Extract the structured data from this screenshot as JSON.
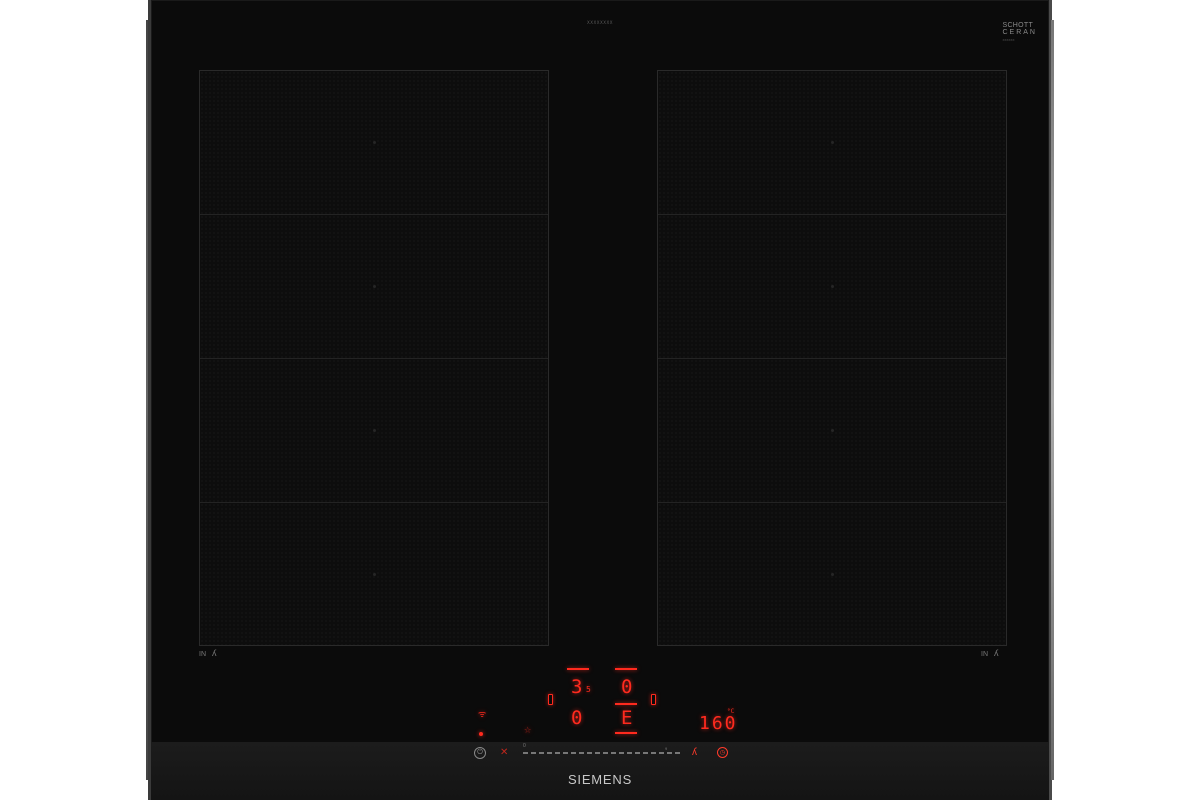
{
  "model_text": "XXXXXXXX",
  "certification": {
    "line1": "SCHOTT",
    "line2": "CERAN",
    "line3": "XXXXXX"
  },
  "zones": {
    "left": {
      "label": "IN",
      "symbol": "ʎ"
    },
    "right": {
      "label": "IN",
      "symbol": "ʎ"
    }
  },
  "display": {
    "top_left_value": "3",
    "top_left_sub": "5",
    "top_right_value": "0",
    "bottom_left_value": "0",
    "bottom_right_value": "E",
    "temperature_value": "160",
    "temperature_unit": "°C",
    "star_symbol": "☆",
    "wifi_symbol": "ᯤ"
  },
  "controls": {
    "power_symbol": "⏻",
    "remove_symbol": "✕",
    "slider_min": "0",
    "slider_max": "9",
    "fry_symbol": "ʎ",
    "timer_symbol": "◷"
  },
  "brand": "SIEMENS",
  "colors": {
    "glass": "#0b0b0b",
    "display_red": "#ff2a1e",
    "frame": "#888888"
  }
}
